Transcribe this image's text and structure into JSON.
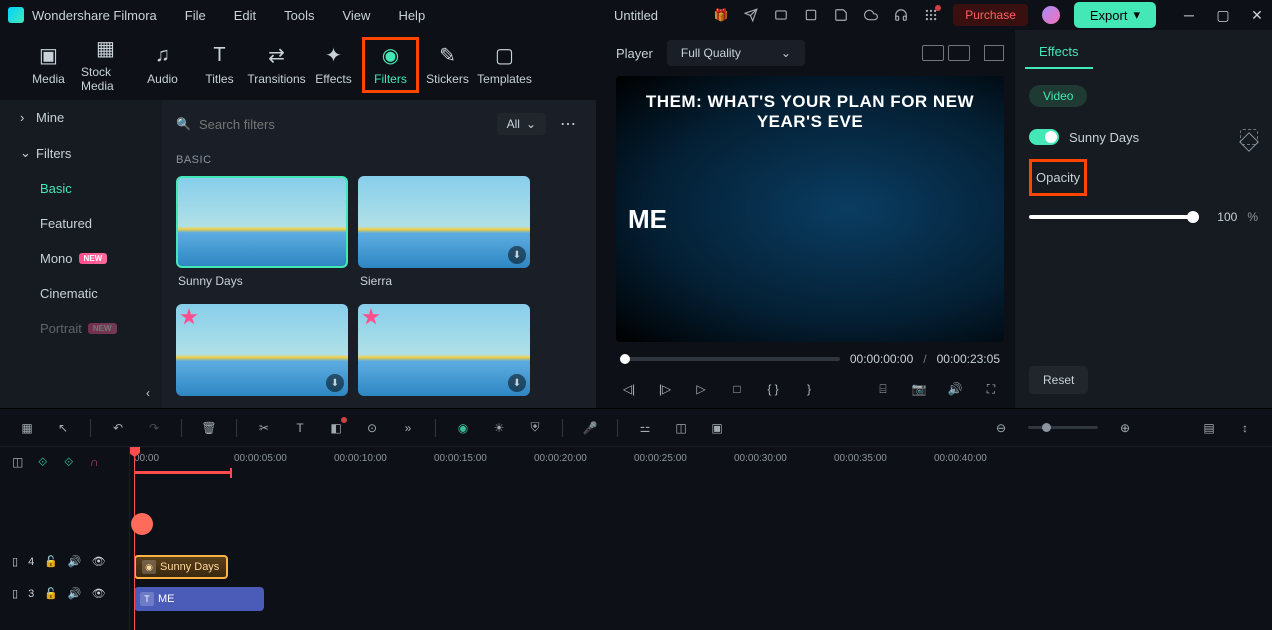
{
  "app_name": "Wondershare Filmora",
  "menu": [
    "File",
    "Edit",
    "Tools",
    "View",
    "Help"
  ],
  "project_title": "Untitled",
  "purchase": "Purchase",
  "export": "Export",
  "main_tabs": [
    {
      "label": "Media",
      "icon": "▣"
    },
    {
      "label": "Stock Media",
      "icon": "▦"
    },
    {
      "label": "Audio",
      "icon": "♫"
    },
    {
      "label": "Titles",
      "icon": "T"
    },
    {
      "label": "Transitions",
      "icon": "⇄"
    },
    {
      "label": "Effects",
      "icon": "✦"
    },
    {
      "label": "Filters",
      "icon": "◉",
      "active": true,
      "highlighted": true
    },
    {
      "label": "Stickers",
      "icon": "✎"
    },
    {
      "label": "Templates",
      "icon": "▢"
    }
  ],
  "sidebar": {
    "mine": "Mine",
    "filters": "Filters",
    "items": [
      {
        "label": "Basic",
        "active": true
      },
      {
        "label": "Featured"
      },
      {
        "label": "Mono",
        "new": true
      },
      {
        "label": "Cinematic"
      },
      {
        "label": "Portrait",
        "new": true
      }
    ]
  },
  "search": {
    "placeholder": "Search filters",
    "dropdown": "All"
  },
  "section_label": "BASIC",
  "thumbs": [
    {
      "name": "Sunny Days",
      "selected": true
    },
    {
      "name": "Sierra",
      "dl": true
    },
    {
      "name": "",
      "fav": true,
      "dl": true
    },
    {
      "name": "",
      "fav": true,
      "dl": true
    }
  ],
  "player": {
    "label": "Player",
    "quality": "Full Quality",
    "text_them": "THEM: WHAT'S YOUR PLAN FOR NEW YEAR'S EVE",
    "text_me": "ME",
    "current": "00:00:00:00",
    "duration": "00:00:23:05"
  },
  "effects_panel": {
    "tab": "Effects",
    "pill": "Video",
    "filter_name": "Sunny Days",
    "opacity_label": "Opacity",
    "opacity_value": "100",
    "opacity_unit": "%",
    "reset": "Reset"
  },
  "timeline": {
    "ticks": [
      "00:00",
      "00:00:05:00",
      "00:00:10:00",
      "00:00:15:00",
      "00:00:20:00",
      "00:00:25:00",
      "00:00:30:00",
      "00:00:35:00",
      "00:00:40:00"
    ],
    "clip_filter": "Sunny Days",
    "clip_video": "ME",
    "track4": "4",
    "track3": "3"
  }
}
